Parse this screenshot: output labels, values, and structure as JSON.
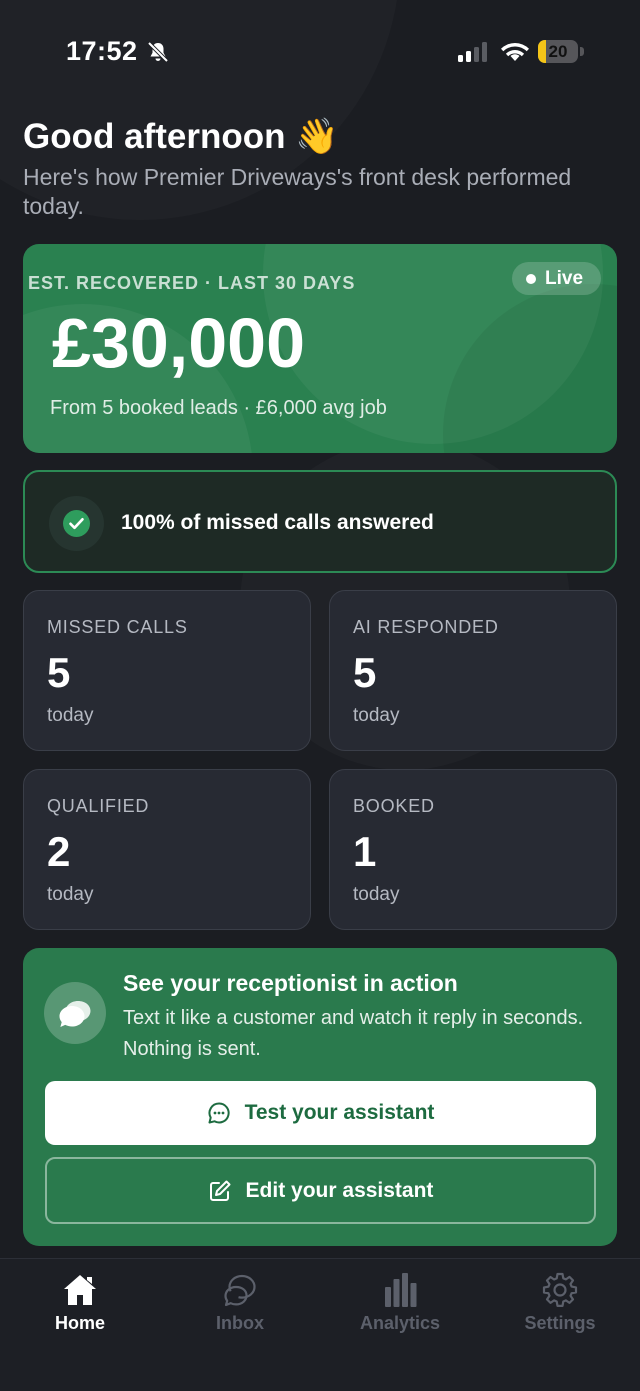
{
  "status_bar": {
    "time": "17:52",
    "battery_level": "20",
    "battery_fraction": 0.2,
    "icons": [
      "bell-muted-icon",
      "signal-icon",
      "wifi-icon",
      "battery-icon"
    ]
  },
  "header": {
    "greeting": "Good afternoon 👋",
    "subtitle": "Here's how Premier Driveways's front desk performed today."
  },
  "hero": {
    "eyebrow": "EST. RECOVERED · LAST 30 DAYS",
    "live_label": "Live",
    "amount": "£30,000",
    "subtext": "From 5 booked leads · £6,000 avg job"
  },
  "answered_banner": {
    "text": "100% of missed calls answered",
    "icon": "check-circle-icon"
  },
  "stats": [
    {
      "label": "MISSED CALLS",
      "value": "5",
      "sub": "today"
    },
    {
      "label": "AI RESPONDED",
      "value": "5",
      "sub": "today"
    },
    {
      "label": "QUALIFIED",
      "value": "2",
      "sub": "today"
    },
    {
      "label": "BOOKED",
      "value": "1",
      "sub": "today"
    }
  ],
  "cta": {
    "title": "See your receptionist in action",
    "body": "Text it like a customer and watch it reply in seconds. Nothing is sent.",
    "primary_button": "Test your assistant",
    "secondary_button": "Edit your assistant",
    "icon": "chat-bubbles-icon"
  },
  "tabs": [
    {
      "label": "Home",
      "icon": "home-icon",
      "active": true
    },
    {
      "label": "Inbox",
      "icon": "chat-icon",
      "active": false
    },
    {
      "label": "Analytics",
      "icon": "bar-chart-icon",
      "active": false
    },
    {
      "label": "Settings",
      "icon": "gear-icon",
      "active": false
    }
  ],
  "colors": {
    "background": "#1b1d22",
    "accent_green": "#2a8150",
    "card": "#272a33",
    "battery_yellow": "#f5c518"
  }
}
